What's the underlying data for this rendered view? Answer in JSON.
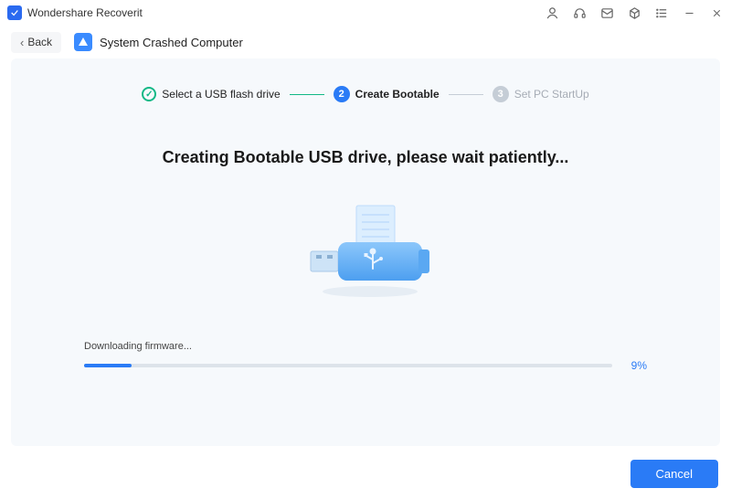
{
  "app": {
    "title": "Wondershare Recoverit"
  },
  "header": {
    "back_label": "Back",
    "section_title": "System Crashed Computer"
  },
  "stepper": {
    "steps": [
      {
        "label": "Select a USB flash drive",
        "state": "done",
        "num": "✓"
      },
      {
        "label": "Create Bootable",
        "state": "active",
        "num": "2"
      },
      {
        "label": "Set PC StartUp",
        "state": "todo",
        "num": "3"
      }
    ]
  },
  "main": {
    "headline": "Creating Bootable USB drive, please wait patiently...",
    "progress_label": "Downloading firmware...",
    "progress_percent_value": 9,
    "progress_percent_display": "9%"
  },
  "footer": {
    "cancel_label": "Cancel"
  },
  "colors": {
    "accent": "#2a7bf6",
    "success": "#12b886"
  }
}
